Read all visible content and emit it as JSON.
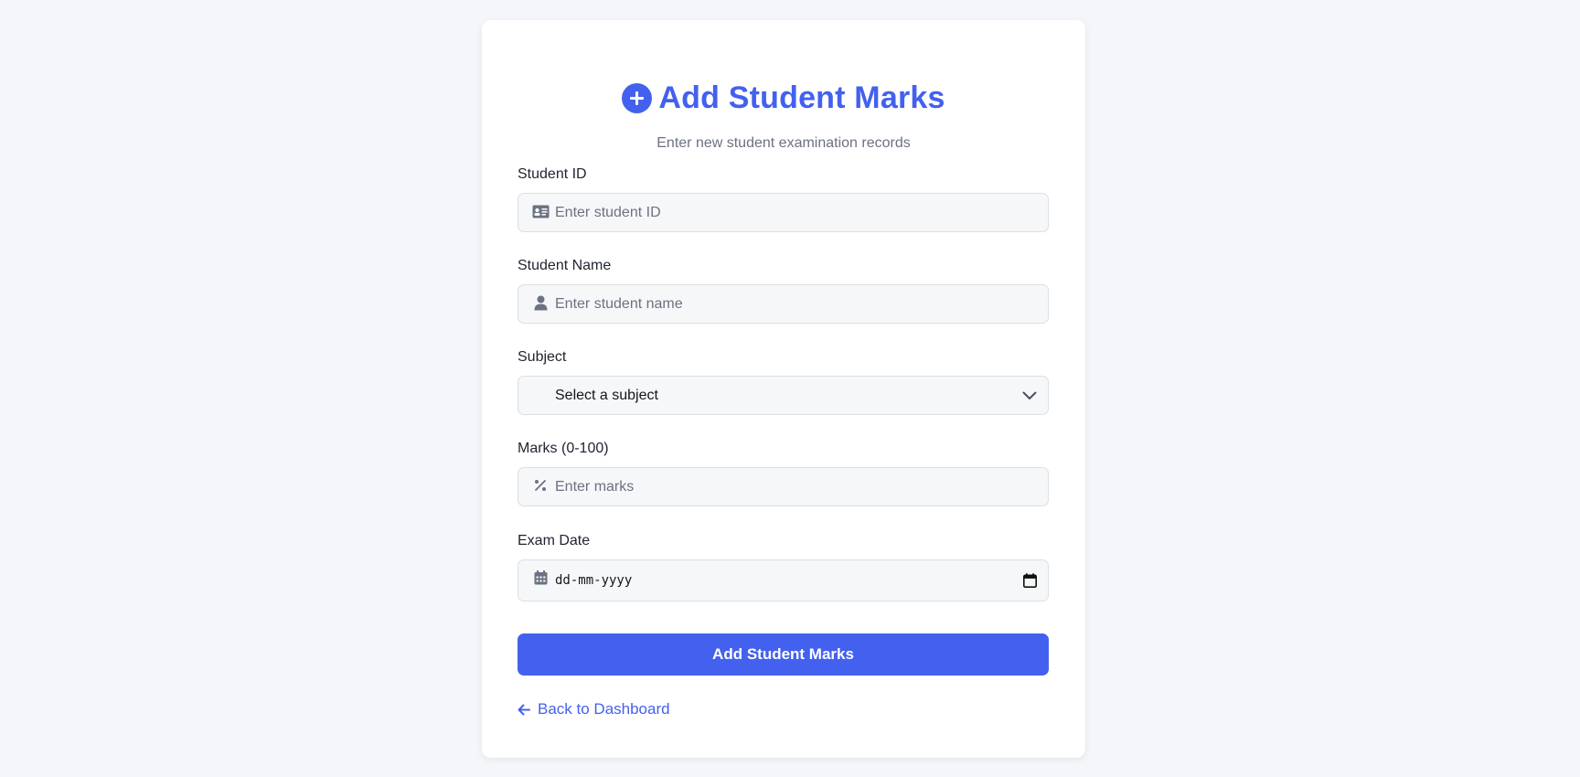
{
  "header": {
    "title": "Add Student Marks",
    "subtitle": "Enter new student examination records",
    "icon": "plus-circle-icon"
  },
  "form": {
    "student_id": {
      "label": "Student ID",
      "placeholder": "Enter student ID",
      "icon": "id-card-icon"
    },
    "student_name": {
      "label": "Student Name",
      "placeholder": "Enter student name",
      "icon": "user-icon"
    },
    "subject": {
      "label": "Subject",
      "selected": "Select a subject",
      "icon": "chevron-down-icon"
    },
    "marks": {
      "label": "Marks (0-100)",
      "placeholder": "Enter marks",
      "icon": "percent-icon"
    },
    "exam_date": {
      "label": "Exam Date",
      "placeholder": "dd-mm-yyyy",
      "icon": "calendar-icon"
    },
    "submit_label": "Add Student Marks"
  },
  "footer": {
    "back_label": "Back to Dashboard",
    "back_icon": "arrow-left-icon"
  },
  "colors": {
    "accent": "#4361ee",
    "background": "#f5f6fa",
    "input_bg": "#f6f7f9",
    "muted_text": "#6b7280"
  }
}
